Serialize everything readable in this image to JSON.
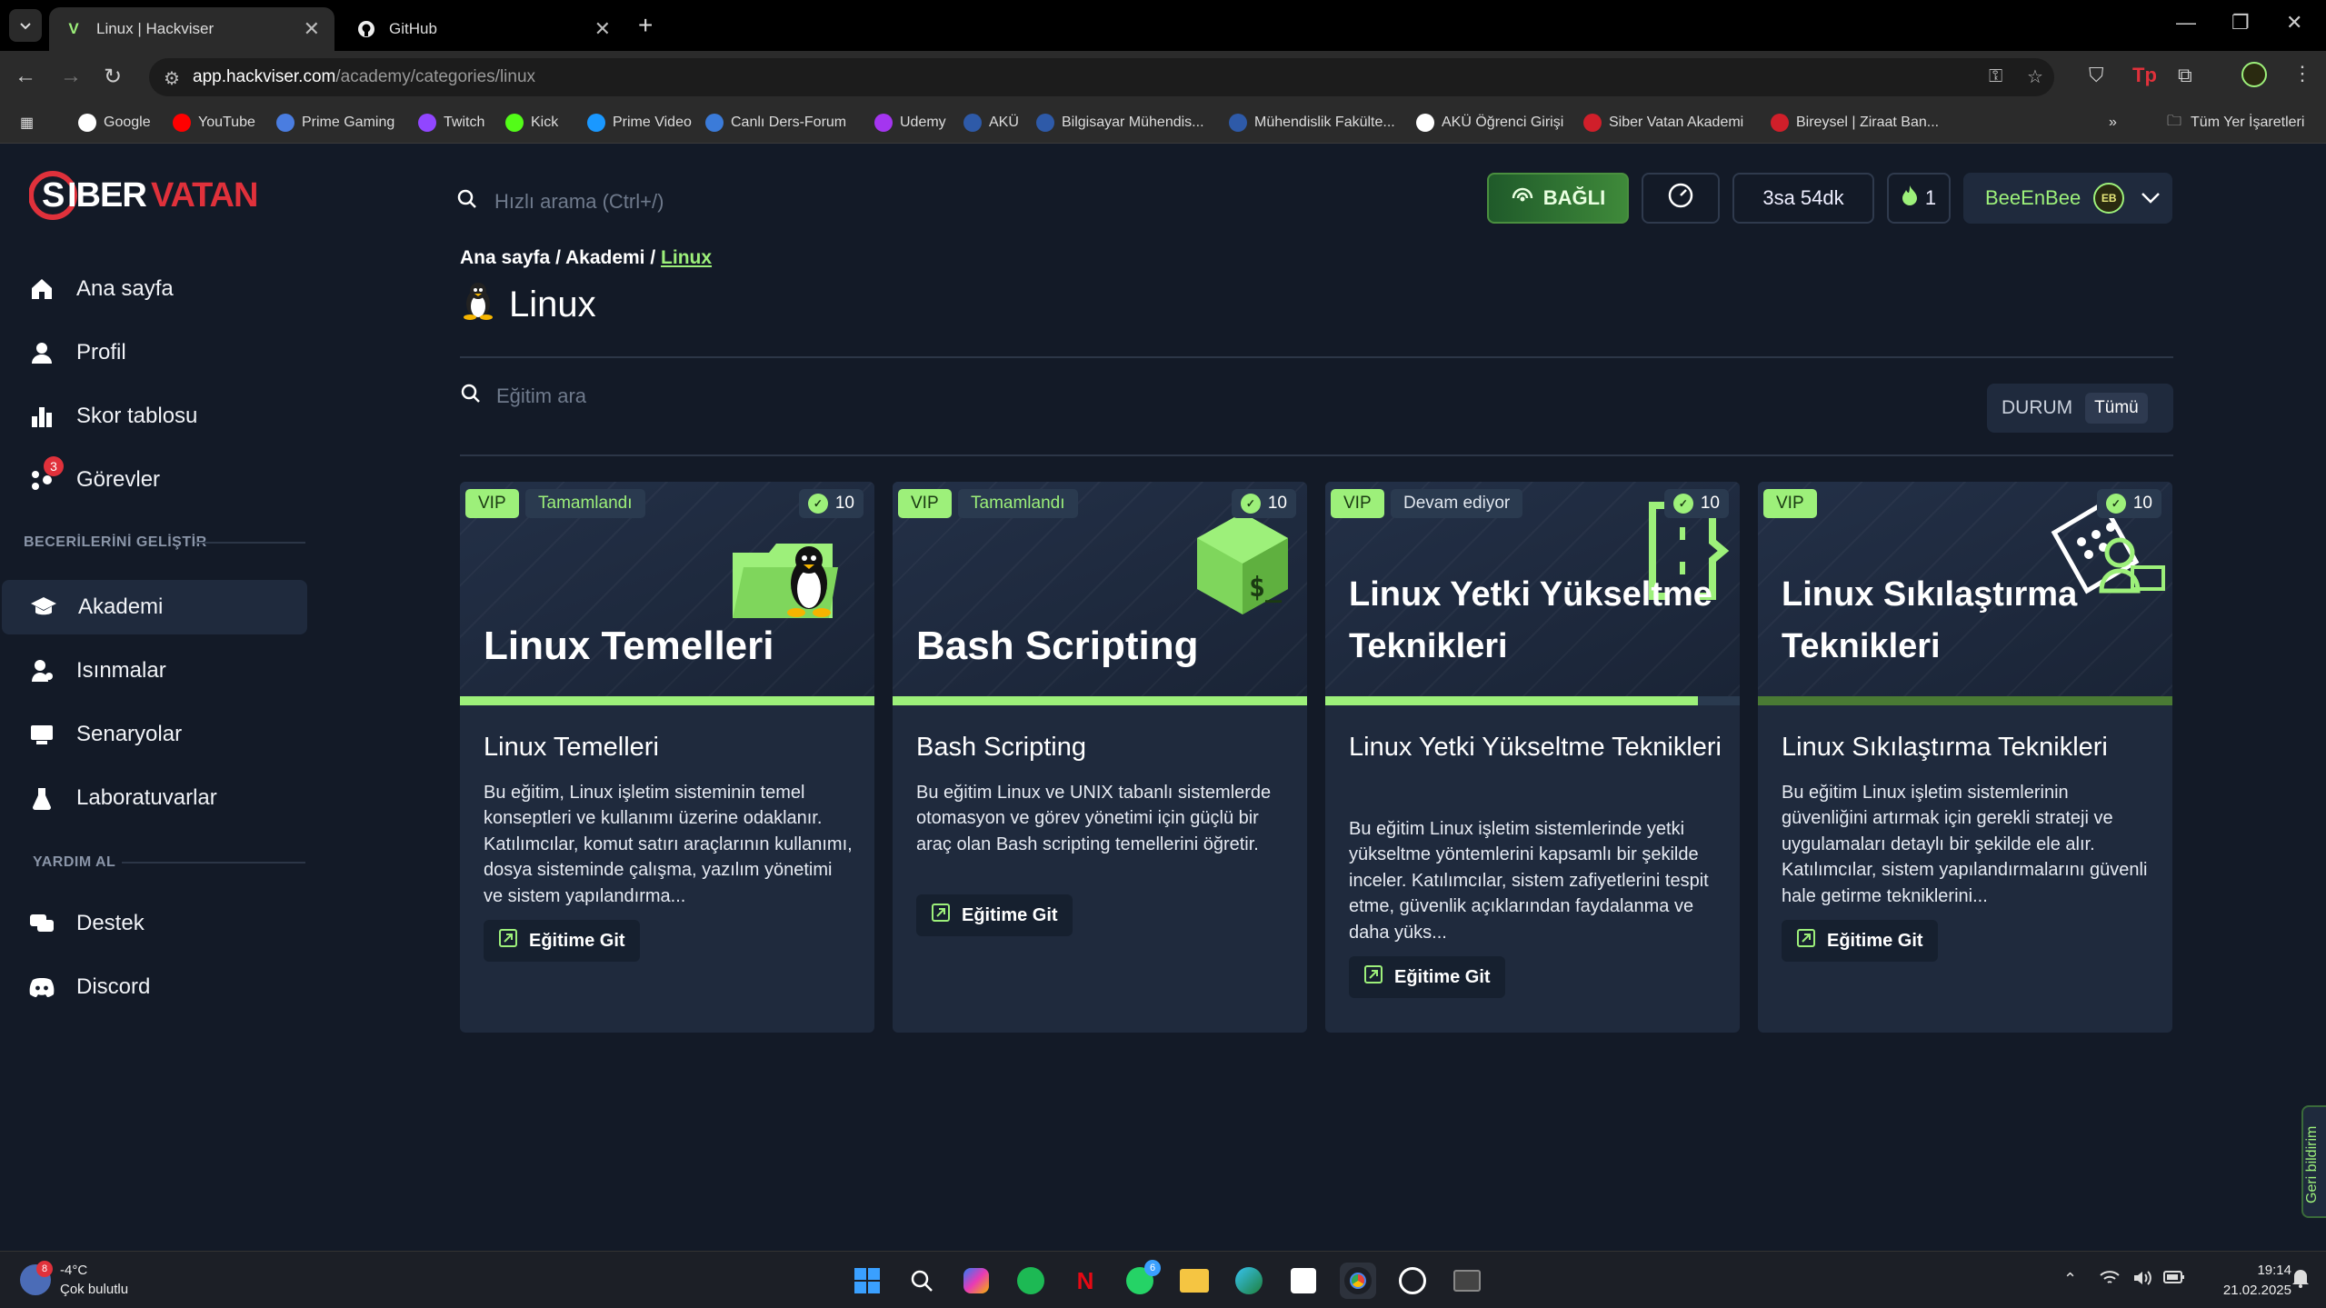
{
  "browser": {
    "tabs": [
      {
        "title": "Linux | Hackviser",
        "active": true
      },
      {
        "title": "GitHub",
        "active": false
      }
    ],
    "url_host": "app.hackviser.com",
    "url_path": "/academy/categories/linux",
    "bookmarks": [
      {
        "label": "Google",
        "icon": "google-icon",
        "color": "#ffffff"
      },
      {
        "label": "YouTube",
        "icon": "youtube-icon",
        "color": "#ff0000"
      },
      {
        "label": "Prime Gaming",
        "icon": "crown-icon",
        "color": "#4a7de0"
      },
      {
        "label": "Twitch",
        "icon": "twitch-icon",
        "color": "#9146ff"
      },
      {
        "label": "Kick",
        "icon": "kick-icon",
        "color": "#53fc18"
      },
      {
        "label": "Prime Video",
        "icon": "play-icon",
        "color": "#1a98ff"
      },
      {
        "label": "Canlı Ders-Forum",
        "icon": "forum-icon",
        "color": "#3b7bd9"
      },
      {
        "label": "Udemy",
        "icon": "udemy-icon",
        "color": "#a435f0"
      },
      {
        "label": "AKÜ",
        "icon": "aku-icon",
        "color": "#2e5aa8"
      },
      {
        "label": "Bilgisayar Mühendis...",
        "icon": "aku-icon",
        "color": "#2e5aa8"
      },
      {
        "label": "Mühendislik Fakülte...",
        "icon": "aku-icon",
        "color": "#2e5aa8"
      },
      {
        "label": "AKÜ Öğrenci Girişi",
        "icon": "login-icon",
        "color": "#ffffff"
      },
      {
        "label": "Siber Vatan Akademi",
        "icon": "sibervatan-icon",
        "color": "#d01f2a"
      },
      {
        "label": "Bireysel | Ziraat Ban...",
        "icon": "bank-icon",
        "color": "#d01f2a"
      }
    ],
    "all_bookmarks_label": "Tüm Yer İşaretleri"
  },
  "brand": {
    "logo_text": "SIBERVATAN"
  },
  "sidebar": {
    "items": [
      {
        "label": "Ana sayfa",
        "icon": "home-icon"
      },
      {
        "label": "Profil",
        "icon": "user-icon"
      },
      {
        "label": "Skor tablosu",
        "icon": "bar-chart-icon"
      },
      {
        "label": "Görevler",
        "icon": "tasks-icon",
        "badge": "3"
      }
    ],
    "section1_title": "BECERİLERİNİ GELİŞTİR",
    "items2": [
      {
        "label": "Akademi",
        "icon": "graduation-cap-icon",
        "active": true
      },
      {
        "label": "Isınmalar",
        "icon": "warmup-icon"
      },
      {
        "label": "Senaryolar",
        "icon": "scenario-icon"
      },
      {
        "label": "Laboratuvarlar",
        "icon": "flask-icon"
      }
    ],
    "section2_title": "YARDIM AL",
    "items3": [
      {
        "label": "Destek",
        "icon": "chat-icon"
      },
      {
        "label": "Discord",
        "icon": "discord-icon"
      }
    ]
  },
  "header": {
    "search_placeholder": "Hızlı arama (Ctrl+/)",
    "connected_label": "BAĞLI",
    "timer": "3sa 54dk",
    "streak": "1",
    "username": "BeeEnBee",
    "avatar_initials": "EB"
  },
  "breadcrumb": {
    "home": "Ana sayfa",
    "academy": "Akademi",
    "current": "Linux",
    "sep": "/"
  },
  "page_title": "Linux",
  "filter": {
    "placeholder": "Eğitim ara",
    "status_label": "DURUM",
    "status_value": "Tümü"
  },
  "cards": [
    {
      "vip": "VIP",
      "state": "Tamamlandı",
      "xp": "10",
      "banner_title": "Linux Temelleri",
      "title": "Linux Temelleri",
      "desc": "Bu eğitim, Linux işletim sisteminin temel konseptleri ve kullanımı üzerine odaklanır. Katılımcılar, komut satırı araçlarının kullanımı, dosya sisteminde çalışma, yazılım yönetimi ve sistem yapılandırma...",
      "button": "Eğitime Git",
      "progress": 1.0
    },
    {
      "vip": "VIP",
      "state": "Tamamlandı",
      "xp": "10",
      "banner_title": "Bash Scripting",
      "title": "Bash Scripting",
      "desc": "Bu eğitim Linux ve UNIX tabanlı sistemlerde otomasyon ve görev yönetimi için güçlü bir araç olan Bash scripting temellerini öğretir.",
      "button": "Eğitime Git",
      "progress": 1.0
    },
    {
      "vip": "VIP",
      "state": "Devam ediyor",
      "xp": "10",
      "banner_title": "Linux Yetki Yükseltme Teknikleri",
      "title": "Linux Yetki Yükseltme Teknikleri",
      "desc": "Bu eğitim Linux işletim sistemlerinde yetki yükseltme yöntemlerini kapsamlı bir şekilde inceler. Katılımcılar, sistem zafiyetlerini tespit etme, güvenlik açıklarından faydalanma ve daha yüks...",
      "button": "Eğitime Git",
      "progress": 0.9
    },
    {
      "vip": "VIP",
      "state": "",
      "xp": "10",
      "banner_title": "Linux Sıkılaştırma Teknikleri",
      "title": "Linux Sıkılaştırma Teknikleri",
      "desc": "Bu eğitim Linux işletim sistemlerinin güvenliğini artırmak için gerekli strateji ve uygulamaları detaylı bir şekilde ele alır. Katılımcılar, sistem yapılandırmalarını güvenli hale getirme tekniklerini...",
      "button": "Eğitime Git",
      "progress": 0.0
    }
  ],
  "feedback_label": "Geri bildirim",
  "taskbar": {
    "temp": "-4°C",
    "weather": "Çok bulutlu",
    "weather_badge": "8",
    "whatsapp_badge": "6",
    "time": "19:14",
    "date": "21.02.2025"
  },
  "colors": {
    "accent": "#9df07a",
    "bg": "#131a27",
    "card": "#1f2a3d",
    "brand_red": "#e0313b"
  }
}
